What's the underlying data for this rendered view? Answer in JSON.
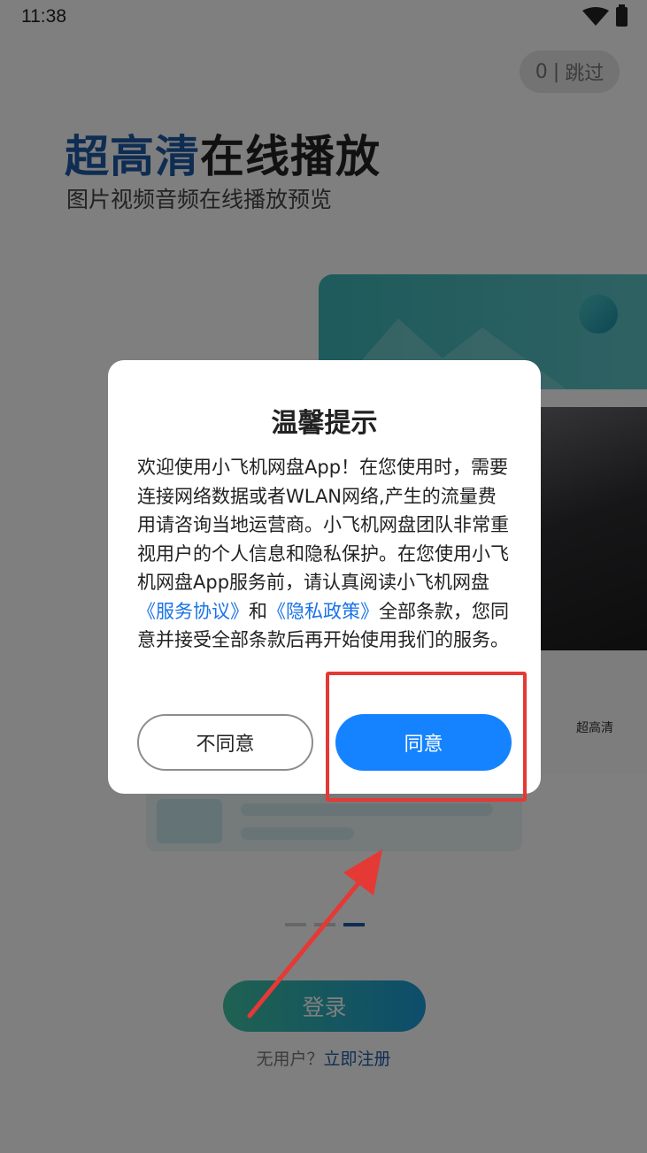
{
  "status_bar": {
    "time": "11:38",
    "icons": [
      "wifi-icon",
      "battery-icon"
    ]
  },
  "skip": {
    "count": "0",
    "separator": "|",
    "label": "跳过"
  },
  "headline": {
    "highlight": "超高清",
    "rest": "在线播放"
  },
  "subtitle": "图片视频音频在线播放预览",
  "illustration": {
    "label": "超高清"
  },
  "pager": {
    "total": 3,
    "active": 3
  },
  "login": {
    "button_label": "登录",
    "register_question": "无用户？",
    "register_link": "立即注册"
  },
  "dialog": {
    "title": "温馨提示",
    "body_part1": "欢迎使用小飞机网盘App！在您使用时，需要连接网络数据或者WLAN网络,产生的流量费用请咨询当地运营商。小飞机网盘团队非常重视用户的个人信息和隐私保护。在您使用小飞机网盘App服务前，请认真阅读小飞机网盘",
    "service_link": "《服务协议》",
    "and": "和",
    "privacy_link": "《隐私政策》",
    "body_part2": "全部条款，您同意并接受全部条款后再开始使用我们的服务。",
    "decline_label": "不同意",
    "agree_label": "同意"
  },
  "colors": {
    "brand_blue": "#1f5aa6",
    "agree_blue": "#1583ff",
    "link_blue": "#1a73e8",
    "annotation_red": "#e53935"
  }
}
